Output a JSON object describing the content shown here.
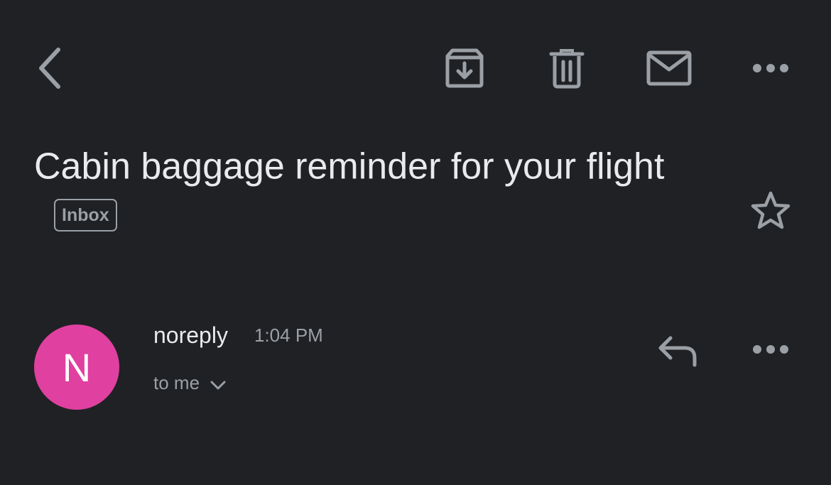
{
  "colors": {
    "background": "#202124",
    "icon": "#9aa0a6",
    "text_primary": "#e8eaed",
    "text_secondary": "#9aa0a6",
    "avatar": "#e040a0"
  },
  "toolbar": {
    "back_icon": "chevron-left-icon",
    "archive_icon": "archive-icon",
    "delete_icon": "trash-icon",
    "mark_unread_icon": "mail-icon",
    "more_icon": "more-horizontal-icon"
  },
  "email": {
    "subject": "Cabin baggage reminder for your flight",
    "label": "Inbox",
    "starred": false
  },
  "message": {
    "avatar_letter": "N",
    "sender": "noreply",
    "time": "1:04 PM",
    "recipient": "to me",
    "reply_icon": "reply-icon",
    "more_icon": "more-horizontal-icon"
  }
}
